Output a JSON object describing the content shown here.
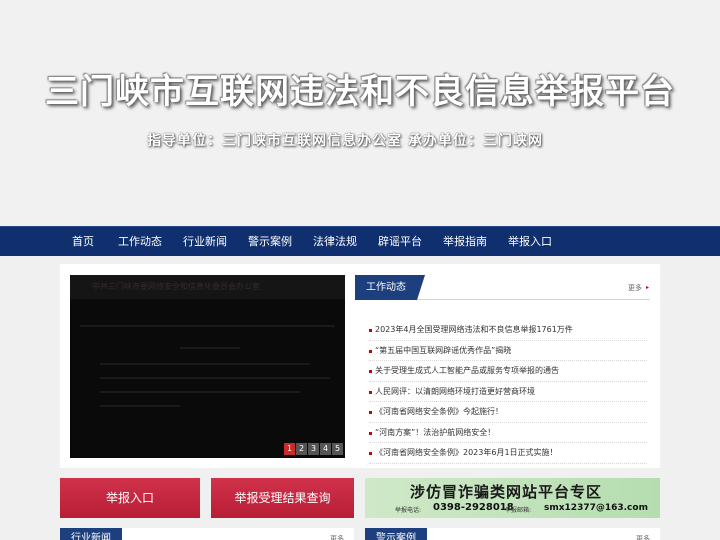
{
  "banner": {
    "title": "三门峡市互联网违法和不良信息举报平台",
    "subtitle": "指导单位：三门峡市互联网信息办公室   承办单位：三门峡网"
  },
  "nav": {
    "items": [
      "首页",
      "工作动态",
      "行业新闻",
      "警示案例",
      "法律法规",
      "辟谣平台",
      "举报指南",
      "举报入口"
    ]
  },
  "slider": {
    "title": "中共三门峡市委网络安全和信息化委员会办公室",
    "pages": [
      "1",
      "2",
      "3",
      "4",
      "5"
    ],
    "active_page": "1"
  },
  "news": {
    "tab": "工作动态",
    "more": "更多",
    "items": [
      "2023年4月全国受理网络违法和不良信息举报1761万件",
      "“第五届中国互联网辟谣优秀作品”揭晓",
      "关于受理生成式人工智能产品或服务专项举报的通告",
      "人民网评：以清朗网络环境打造更好营商环境",
      "《河南省网络安全条例》今起施行！",
      "“河南方案”！法治护航网络安全！",
      "《河南省网络安全条例》2023年6月1日正式实施！"
    ]
  },
  "buttons": {
    "report": "举报入口",
    "result": "举报受理结果查询"
  },
  "ad": {
    "title": "涉仿冒诈骗类网站平台专区",
    "phone_label": "举报电话:",
    "phone": "0398-2928018",
    "email_label": "举报邮箱:",
    "email": "smx12377@163.com"
  },
  "panels": {
    "left_tab": "行业新闻",
    "right_tab": "警示案例",
    "more": "更多"
  },
  "colors": {
    "nav_bg": "#0f2f6e",
    "tab_bg": "#1e3f7d",
    "button_red": "#c42a40",
    "ad_green": "#c5e4bf",
    "bullet_red": "#cc0000"
  }
}
